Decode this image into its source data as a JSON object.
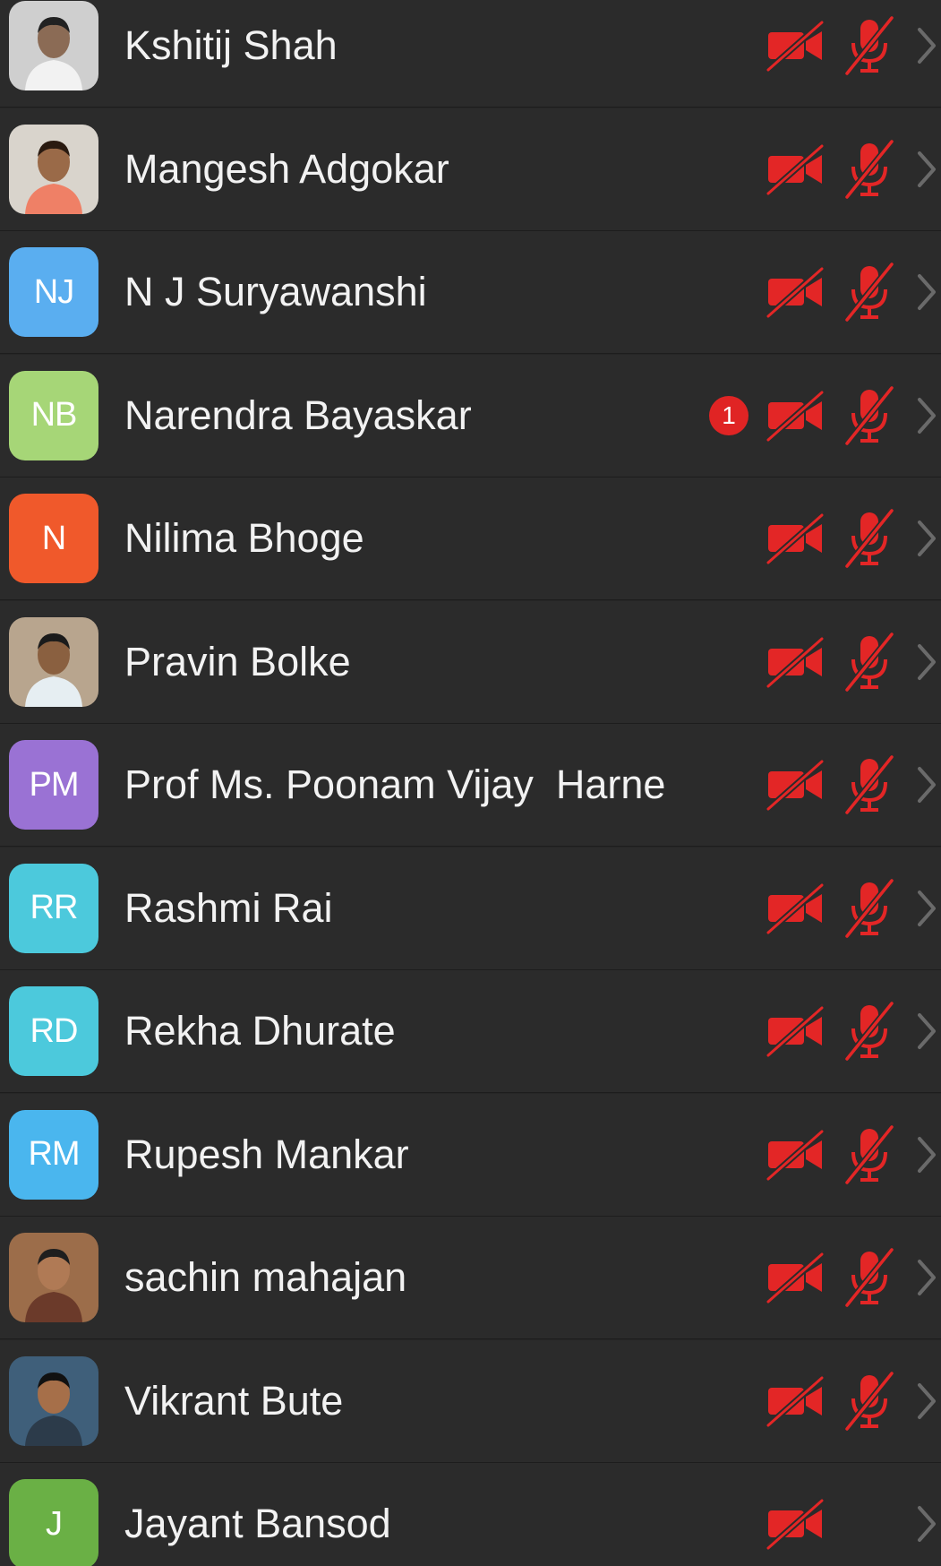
{
  "colors": {
    "background": "#262626",
    "row": "#2b2b2b",
    "muted_red": "#e32626",
    "chevron": "#6a6a6a",
    "name_text": "#f2f2f2"
  },
  "participants": [
    {
      "name": "Kshitij Shah",
      "avatar_type": "photo",
      "avatar_icon": "person-photo-icon",
      "video_off": true,
      "mic_muted": true
    },
    {
      "name": "Mangesh Adgokar",
      "avatar_type": "photo",
      "avatar_icon": "person-photo-icon",
      "video_off": true,
      "mic_muted": true
    },
    {
      "name": "N J Suryawanshi",
      "avatar_type": "initials",
      "initials": "NJ",
      "avatar_color": "#5aaef0",
      "video_off": true,
      "mic_muted": true
    },
    {
      "name": "Narendra Bayaskar",
      "avatar_type": "initials",
      "initials": "NB",
      "avatar_color": "#a6d677",
      "badge": "1",
      "video_off": true,
      "mic_muted": true
    },
    {
      "name": "Nilima Bhoge",
      "avatar_type": "initials",
      "initials": "N",
      "avatar_color": "#f0592b",
      "video_off": true,
      "mic_muted": true
    },
    {
      "name": "Pravin Bolke",
      "avatar_type": "photo",
      "avatar_icon": "person-photo-icon",
      "video_off": true,
      "mic_muted": true
    },
    {
      "name": "Prof Ms. Poonam Vijay  Harne",
      "avatar_type": "initials",
      "initials": "PM",
      "avatar_color": "#9a72d4",
      "video_off": true,
      "mic_muted": true
    },
    {
      "name": "Rashmi Rai",
      "avatar_type": "initials",
      "initials": "RR",
      "avatar_color": "#4cc9dc",
      "video_off": true,
      "mic_muted": true
    },
    {
      "name": "Rekha Dhurate",
      "avatar_type": "initials",
      "initials": "RD",
      "avatar_color": "#4cc9dc",
      "video_off": true,
      "mic_muted": true
    },
    {
      "name": "Rupesh Mankar",
      "avatar_type": "initials",
      "initials": "RM",
      "avatar_color": "#4ab6ee",
      "video_off": true,
      "mic_muted": true
    },
    {
      "name": "sachin mahajan",
      "avatar_type": "photo",
      "avatar_icon": "person-photo-icon",
      "video_off": true,
      "mic_muted": true
    },
    {
      "name": "Vikrant Bute",
      "avatar_type": "photo",
      "avatar_icon": "person-photo-icon",
      "video_off": true,
      "mic_muted": true
    },
    {
      "name": "Jayant Bansod",
      "avatar_type": "initials",
      "initials": "J",
      "avatar_color": "#6ab045",
      "video_off": true,
      "mic_muted": false
    }
  ]
}
